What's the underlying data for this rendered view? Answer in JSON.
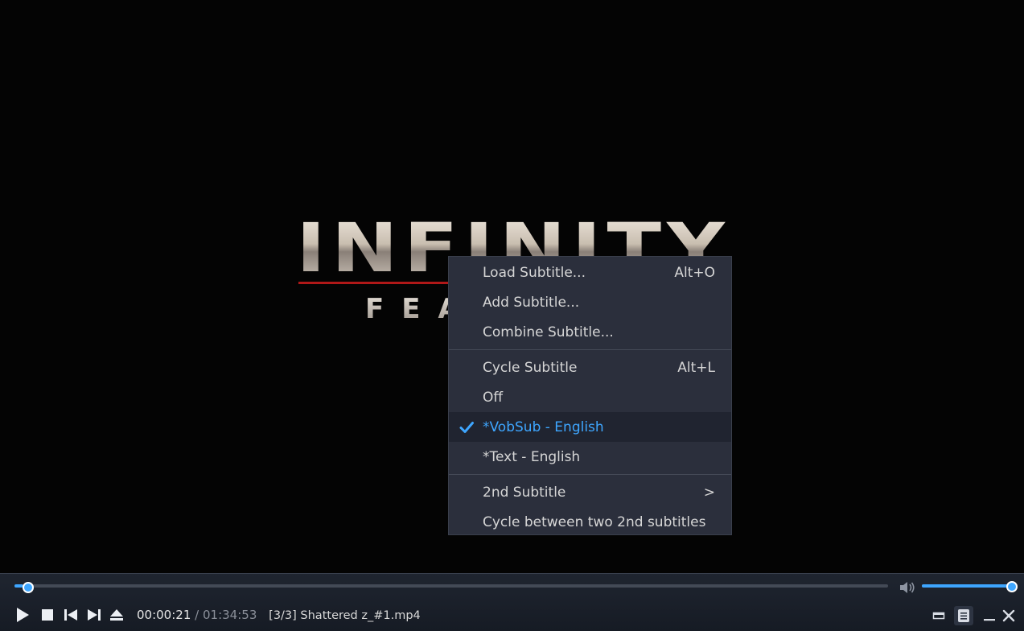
{
  "video": {
    "logo_text_main": "INFINITY",
    "logo_text_sub": "FEA"
  },
  "menu": {
    "items": [
      {
        "label": "Load Subtitle...",
        "shortcut": "Alt+O"
      },
      {
        "label": "Add Subtitle...",
        "shortcut": ""
      },
      {
        "label": "Combine Subtitle...",
        "shortcut": ""
      },
      {
        "label": "Cycle Subtitle",
        "shortcut": "Alt+L"
      },
      {
        "label": "Off",
        "shortcut": ""
      },
      {
        "label": "*VobSub - English",
        "shortcut": "",
        "checked": true
      },
      {
        "label": "*Text - English",
        "shortcut": ""
      },
      {
        "label": "2nd Subtitle",
        "shortcut": ">"
      },
      {
        "label": "Cycle between two 2nd subtitles",
        "shortcut": ""
      }
    ]
  },
  "controls": {
    "seek_progress": 0.01,
    "volume_level": 1.0,
    "current_time": "00:00:21",
    "separator": "/",
    "duration": "01:34:53",
    "file_label": "[3/3] Shattered z_#1.mp4",
    "buttons": [
      "play-icon",
      "stop-icon",
      "previous-icon",
      "next-icon",
      "eject-icon"
    ],
    "right_buttons": [
      "compact-mode-icon",
      "playlist-icon",
      "minimize-icon",
      "close-icon"
    ]
  },
  "colors": {
    "accent": "#3ea6ff",
    "menu_bg": "#2b2f3c",
    "controls_bg": "#1b212b"
  }
}
